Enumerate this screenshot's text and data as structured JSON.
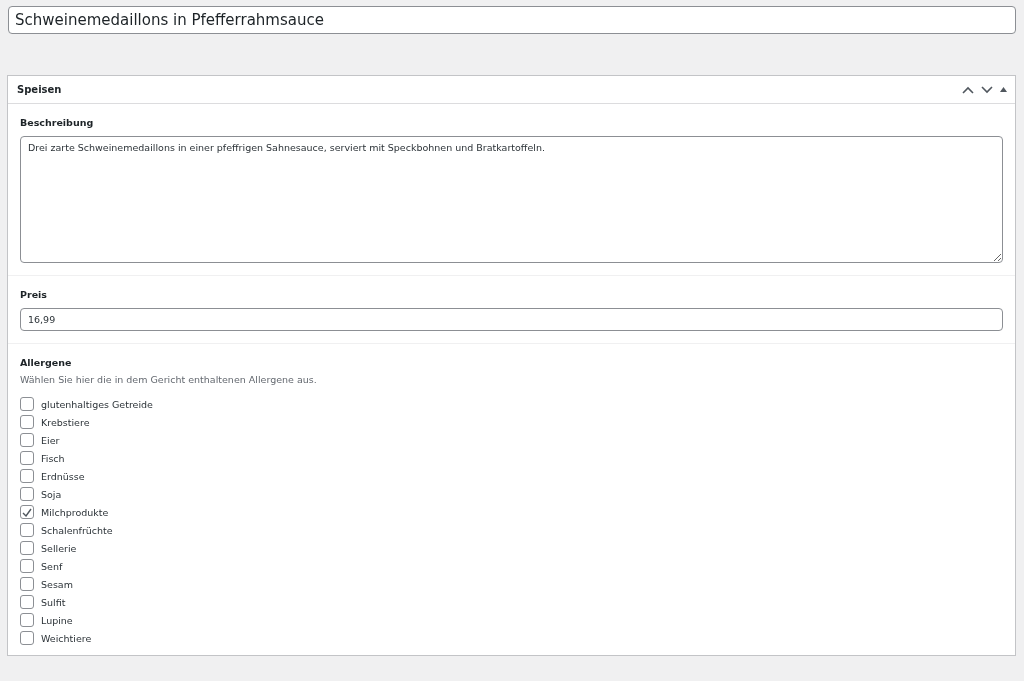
{
  "title_field": {
    "value": "Schweinemedaillons in Pfefferrahmsauce"
  },
  "panel": {
    "title": "Speisen",
    "description": {
      "label": "Beschreibung",
      "value": "Drei zarte Schweinemedaillons in einer pfeffrigen Sahnesauce, serviert mit Speckbohnen und Bratkartoffeln."
    },
    "price": {
      "label": "Preis",
      "value": "16,99"
    },
    "allergens": {
      "label": "Allergene",
      "hint": "Wählen Sie hier die in dem Gericht enthaltenen Allergene aus.",
      "items": [
        {
          "label": "glutenhaltiges Getreide",
          "checked": false
        },
        {
          "label": "Krebstiere",
          "checked": false
        },
        {
          "label": "Eier",
          "checked": false
        },
        {
          "label": "Fisch",
          "checked": false
        },
        {
          "label": "Erdnüsse",
          "checked": false
        },
        {
          "label": "Soja",
          "checked": false
        },
        {
          "label": "Milchprodukte",
          "checked": true
        },
        {
          "label": "Schalenfrüchte",
          "checked": false
        },
        {
          "label": "Sellerie",
          "checked": false
        },
        {
          "label": "Senf",
          "checked": false
        },
        {
          "label": "Sesam",
          "checked": false
        },
        {
          "label": "Sulfit",
          "checked": false
        },
        {
          "label": "Lupine",
          "checked": false
        },
        {
          "label": "Weichtiere",
          "checked": false
        }
      ]
    }
  }
}
